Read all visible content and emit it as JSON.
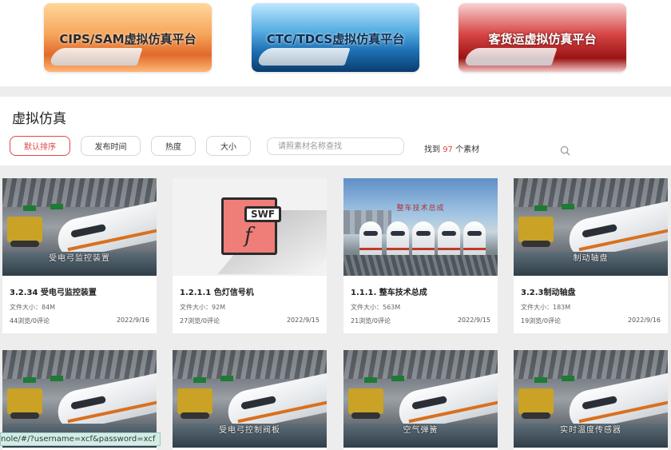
{
  "banners": [
    {
      "label": "CIPS/SAM虚拟仿真平台"
    },
    {
      "label": "CTC/TDCS虚拟仿真平台"
    },
    {
      "label": "客货运虚拟仿真平台"
    }
  ],
  "section": {
    "title": "虚拟仿真",
    "sort_buttons": [
      {
        "label": "默认排序",
        "active": true
      },
      {
        "label": "发布时间",
        "active": false
      },
      {
        "label": "热度",
        "active": false
      },
      {
        "label": "大小",
        "active": false
      }
    ],
    "search": {
      "placeholder": "请照素材名称查找",
      "value": ""
    },
    "found": {
      "prefix": "找到",
      "count": "97",
      "suffix": "个素材"
    }
  },
  "cards": [
    {
      "title": "3.2.34 受电弓监控装置",
      "size": "文件大小：84M",
      "stats": "44浏览/0评论",
      "date": "2022/9/16",
      "thumb": "station",
      "caption": "受电弓监控装置"
    },
    {
      "title": "1.2.1.1 色灯信号机",
      "size": "文件大小：92M",
      "stats": "27浏览/0评论",
      "date": "2022/9/15",
      "thumb": "swf",
      "swf_tag": "SWF",
      "swf_glyph": "f"
    },
    {
      "title": "1.1.1. 整车技术总成",
      "size": "文件大小：563M",
      "stats": "21浏览/0评论",
      "date": "2022/9/15",
      "thumb": "platform",
      "caption": "整车技术总成"
    },
    {
      "title": "3.2.3制动轴盘",
      "size": "文件大小：183M",
      "stats": "19浏览/0评论",
      "date": "2022/9/16",
      "thumb": "station",
      "caption": "制动轴盘"
    },
    {
      "thumb": "station",
      "caption": ""
    },
    {
      "thumb": "station",
      "caption": "受电弓控制阀板"
    },
    {
      "thumb": "station",
      "caption": "空气弹簧"
    },
    {
      "thumb": "station",
      "caption": "实时温度传感器"
    }
  ],
  "status_url": "nole/#/?username=xcf&password=xcf",
  "colors": {
    "accent": "#e04646",
    "background": "#ededed"
  },
  "icons": [
    "search-icon",
    "swf-file-icon"
  ]
}
